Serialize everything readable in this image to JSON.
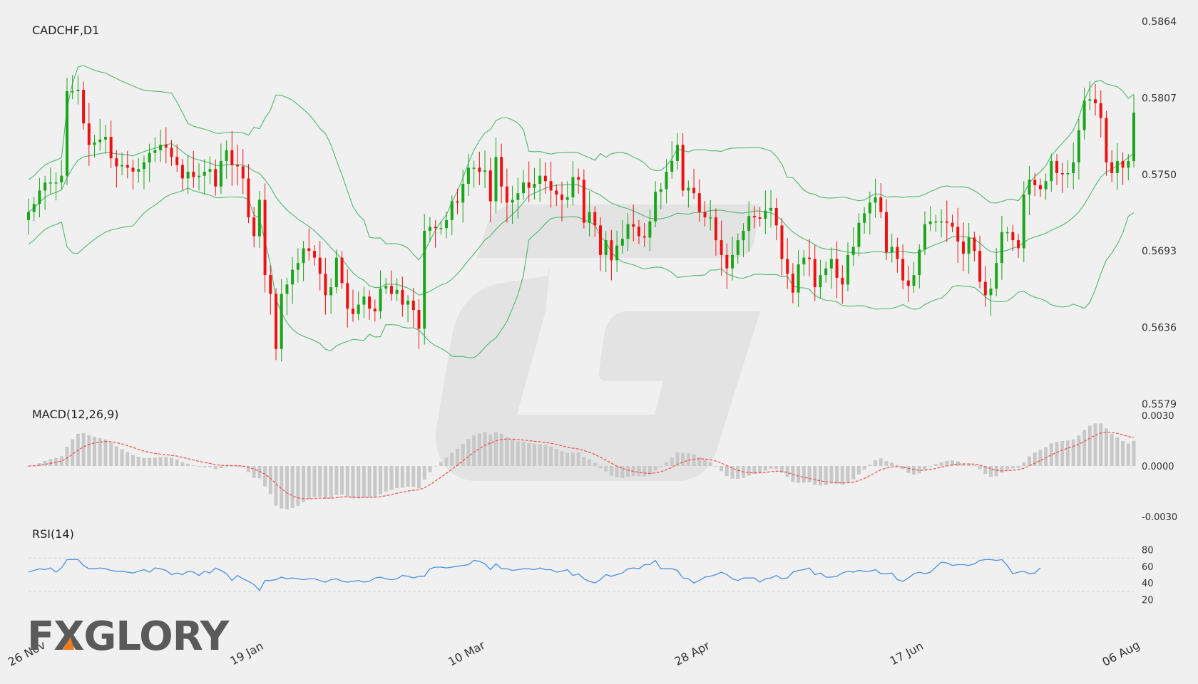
{
  "chart_data": [
    {
      "type": "candlestick",
      "title": "CADCHF,D1",
      "indicators": [
        "Bollinger Bands"
      ],
      "ylim": [
        0.5579,
        0.5864
      ],
      "yticks": [
        "0.5864",
        "0.5807",
        "0.5750",
        "0.5693",
        "0.5636",
        "0.5579"
      ],
      "xticks": [
        "26 Nov",
        "19 Jan",
        "10 Mar",
        "28 Apr",
        "17 Jun",
        "06 Aug"
      ],
      "close": [
        0.5722,
        0.5728,
        0.5738,
        0.5744,
        0.5744,
        0.5744,
        0.5749,
        0.5812,
        0.5812,
        0.5813,
        0.5788,
        0.5772,
        0.5774,
        0.5776,
        0.5778,
        0.5762,
        0.5756,
        0.5757,
        0.5755,
        0.5752,
        0.5754,
        0.5759,
        0.5766,
        0.5768,
        0.5772,
        0.577,
        0.5763,
        0.5757,
        0.5747,
        0.5752,
        0.5748,
        0.5749,
        0.5752,
        0.5754,
        0.5741,
        0.576,
        0.5768,
        0.5757,
        0.5756,
        0.5747,
        0.5718,
        0.5704,
        0.5731,
        0.5675,
        0.5661,
        0.562,
        0.5661,
        0.5668,
        0.5679,
        0.5684,
        0.5695,
        0.5693,
        0.5688,
        0.5676,
        0.566,
        0.5666,
        0.5688,
        0.5669,
        0.565,
        0.5646,
        0.5653,
        0.5659,
        0.565,
        0.5648,
        0.5665,
        0.5667,
        0.5661,
        0.5664,
        0.5653,
        0.5656,
        0.5649,
        0.5635,
        0.5708,
        0.5711,
        0.571,
        0.571,
        0.5716,
        0.573,
        0.5729,
        0.5743,
        0.5755,
        0.5755,
        0.5752,
        0.5753,
        0.573,
        0.5763,
        0.5741,
        0.5729,
        0.5731,
        0.5736,
        0.5744,
        0.574,
        0.5743,
        0.5749,
        0.5745,
        0.5738,
        0.5735,
        0.5731,
        0.5733,
        0.5748,
        0.5746,
        0.5714,
        0.5722,
        0.5712,
        0.569,
        0.5701,
        0.5686,
        0.5697,
        0.5702,
        0.5713,
        0.5711,
        0.5704,
        0.5703,
        0.5715,
        0.5737,
        0.5739,
        0.5752,
        0.576,
        0.5772,
        0.5738,
        0.574,
        0.5736,
        0.5722,
        0.5718,
        0.5718,
        0.5701,
        0.569,
        0.568,
        0.569,
        0.5701,
        0.5708,
        0.5719,
        0.5718,
        0.5717,
        0.5723,
        0.5725,
        0.5712,
        0.5687,
        0.5676,
        0.5662,
        0.5683,
        0.5688,
        0.5687,
        0.5666,
        0.5675,
        0.568,
        0.5687,
        0.5673,
        0.5668,
        0.569,
        0.5696,
        0.5714,
        0.5721,
        0.5729,
        0.5733,
        0.5722,
        0.5692,
        0.5696,
        0.5687,
        0.5671,
        0.5667,
        0.5675,
        0.5694,
        0.5713,
        0.5715,
        0.5715,
        0.5715,
        0.5714,
        0.5711,
        0.57,
        0.5691,
        0.5703,
        0.5693,
        0.567,
        0.566,
        0.5665,
        0.5684,
        0.5707,
        0.5707,
        0.5701,
        0.5695,
        0.5735,
        0.5746,
        0.5742,
        0.5739,
        0.5745,
        0.576,
        0.5751,
        0.575,
        0.5751,
        0.5759,
        0.5783,
        0.5805,
        0.5806,
        0.5803,
        0.5792,
        0.5759,
        0.5751,
        0.576,
        0.5755,
        0.576,
        0.5796
      ]
    },
    {
      "type": "bar+line",
      "title": "MACD(12,26,9)",
      "ylim": [
        -0.003,
        0.003
      ],
      "yticks": [
        "0.0030",
        "0.0000",
        "-0.0030"
      ]
    },
    {
      "type": "line",
      "title": "RSI(14)",
      "ylim": [
        0,
        100
      ],
      "yticks": [
        "80",
        "60",
        "40",
        "20"
      ],
      "rsi": [
        53,
        55,
        57,
        56,
        58,
        53,
        58,
        68,
        68,
        68,
        61,
        57,
        57,
        58,
        57,
        55,
        54,
        54,
        53,
        52,
        54,
        56,
        53,
        58,
        57,
        55,
        50,
        52,
        50,
        54,
        53,
        49,
        54,
        52,
        58,
        55,
        51,
        43,
        49,
        45,
        42,
        38,
        31,
        43,
        43,
        44,
        47,
        45,
        46,
        45,
        44,
        45,
        45,
        43,
        41,
        44,
        45,
        42,
        41,
        42,
        43,
        41,
        42,
        46,
        47,
        45,
        44,
        45,
        49,
        48,
        46,
        48,
        48,
        57,
        59,
        59,
        58,
        59,
        60,
        61,
        62,
        67,
        66,
        63,
        56,
        63,
        57,
        57,
        55,
        56,
        57,
        57,
        56,
        58,
        56,
        56,
        53,
        54,
        56,
        49,
        51,
        45,
        42,
        40,
        44,
        50,
        48,
        50,
        52,
        57,
        58,
        57,
        62,
        62,
        67,
        57,
        57,
        57,
        55,
        46,
        45,
        40,
        43,
        47,
        48,
        50,
        53,
        50,
        45,
        43,
        46,
        46,
        46,
        41,
        45,
        46,
        49,
        45,
        46,
        53,
        55,
        56,
        58,
        50,
        52,
        47,
        47,
        48,
        52,
        54,
        53,
        55,
        54,
        54,
        56,
        51,
        51,
        52,
        44,
        42,
        46,
        51,
        53,
        51,
        53,
        59,
        65,
        64,
        61,
        62,
        62,
        61,
        63,
        67,
        68,
        68,
        67,
        68,
        61,
        51,
        53,
        54,
        51,
        52,
        58
      ],
      "levels": [
        70,
        30
      ]
    }
  ],
  "brand": {
    "logo_text": "FXGLORY"
  },
  "colors": {
    "up": "#1aa51a",
    "down": "#ee1111",
    "bands": "#4db870",
    "macd_signal": "#f25555",
    "macd_hist": "#c8c8c8",
    "rsi": "#4a90e2"
  }
}
